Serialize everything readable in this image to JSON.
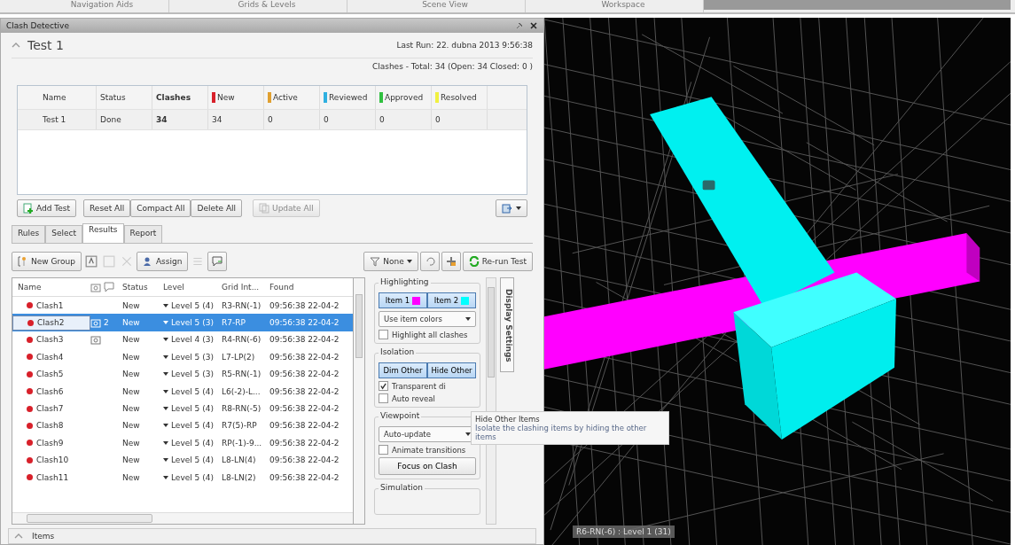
{
  "top_tabs": [
    "Navigation Aids",
    "Grids & Levels",
    "Scene View",
    "Workspace"
  ],
  "panel": {
    "title": "Clash Detective"
  },
  "test": {
    "name": "Test 1",
    "last_run": "Last Run:  22. dubna 2013 9:56:38",
    "summary": "Clashes -  Total:  34  (Open:  34  Closed:  0 )"
  },
  "tests_table": {
    "columns": [
      {
        "label": "Name",
        "kind": "plain"
      },
      {
        "label": "Status",
        "kind": "plain"
      },
      {
        "label": "Clashes",
        "kind": "bold"
      },
      {
        "label": "New",
        "kind": "swatch",
        "color": "#d8202a"
      },
      {
        "label": "Active",
        "kind": "swatch",
        "color": "#e0a030"
      },
      {
        "label": "Reviewed",
        "kind": "swatch",
        "color": "#30b0e0"
      },
      {
        "label": "Approved",
        "kind": "swatch",
        "color": "#30c040"
      },
      {
        "label": "Resolved",
        "kind": "swatch",
        "color": "#f0f040"
      }
    ],
    "rows": [
      [
        "Test 1",
        "Done",
        "34",
        "34",
        "0",
        "0",
        "0",
        "0"
      ]
    ]
  },
  "test_buttons": [
    {
      "label": "Add Test",
      "disabled": false
    },
    {
      "label": "Reset All",
      "disabled": false
    },
    {
      "label": "Compact All",
      "disabled": false
    },
    {
      "label": "Delete All",
      "disabled": false
    },
    {
      "label": "Update All",
      "disabled": true
    }
  ],
  "tabs": [
    {
      "label": "Rules",
      "selected": false
    },
    {
      "label": "Select",
      "selected": false
    },
    {
      "label": "Results",
      "selected": true
    },
    {
      "label": "Report",
      "selected": false
    }
  ],
  "toolbar": {
    "new_group": "New Group",
    "assign": "Assign",
    "filter": "None",
    "rerun": "Re-run Test"
  },
  "results": {
    "columns": [
      "Name",
      "Status",
      "Level",
      "Grid Int...",
      "Found"
    ],
    "rows": [
      {
        "name": "Clash1",
        "viewpoint": false,
        "comments": "",
        "status": "New",
        "level_label": "Level 5 (4)",
        "grid": "R3-RN(-1)",
        "found": "09:56:38 22-04-2",
        "selected": false
      },
      {
        "name": "Clash2",
        "viewpoint": true,
        "comments": "2",
        "status": "New",
        "level_label": "Level 5 (3)",
        "grid": "R7-RP",
        "found": "09:56:38 22-04-2",
        "selected": true
      },
      {
        "name": "Clash3",
        "viewpoint": true,
        "comments": "",
        "status": "New",
        "level_label": "Level 4 (3)",
        "grid": "R4-RN(-6)",
        "found": "09:56:38 22-04-2",
        "selected": false
      },
      {
        "name": "Clash4",
        "viewpoint": false,
        "comments": "",
        "status": "New",
        "level_label": "Level 5 (3)",
        "grid": "L7-LP(2)",
        "found": "09:56:38 22-04-2",
        "selected": false
      },
      {
        "name": "Clash5",
        "viewpoint": false,
        "comments": "",
        "status": "New",
        "level_label": "Level 5 (3)",
        "grid": "R5-RN(-1)",
        "found": "09:56:38 22-04-2",
        "selected": false
      },
      {
        "name": "Clash6",
        "viewpoint": false,
        "comments": "",
        "status": "New",
        "level_label": "Level 5 (4)",
        "grid": "L6(-2)-L...",
        "found": "09:56:38 22-04-2",
        "selected": false
      },
      {
        "name": "Clash7",
        "viewpoint": false,
        "comments": "",
        "status": "New",
        "level_label": "Level 5 (4)",
        "grid": "R8-RN(-5)",
        "found": "09:56:38 22-04-2",
        "selected": false
      },
      {
        "name": "Clash8",
        "viewpoint": false,
        "comments": "",
        "status": "New",
        "level_label": "Level 5 (4)",
        "grid": "R7(5)-RP",
        "found": "09:56:38 22-04-2",
        "selected": false
      },
      {
        "name": "Clash9",
        "viewpoint": false,
        "comments": "",
        "status": "New",
        "level_label": "Level 5 (4)",
        "grid": "RP(-1)-9...",
        "found": "09:56:38 22-04-2",
        "selected": false
      },
      {
        "name": "Clash10",
        "viewpoint": false,
        "comments": "",
        "status": "New",
        "level_label": "Level 5 (4)",
        "grid": "L8-LN(4)",
        "found": "09:56:38 22-04-2",
        "selected": false
      },
      {
        "name": "Clash11",
        "viewpoint": false,
        "comments": "",
        "status": "New",
        "level_label": "Level 5 (4)",
        "grid": "L8-LN(2)",
        "found": "09:56:38 22-04-2",
        "selected": false
      }
    ]
  },
  "display_settings": {
    "tab_label": "Display Settings",
    "highlighting": {
      "title": "Highlighting",
      "items": [
        {
          "label": "Item 1",
          "color": "#ff00ff"
        },
        {
          "label": "Item 2",
          "color": "#00ffff"
        }
      ],
      "mode": "Use item colors",
      "options": [
        {
          "label": "Highlight all clashes",
          "checked": false
        }
      ]
    },
    "isolation": {
      "title": "Isolation",
      "buttons": [
        "Dim Other",
        "Hide Other"
      ],
      "options": [
        {
          "label": "Transparent di",
          "checked": true
        },
        {
          "label": "Auto reveal",
          "checked": false
        }
      ]
    },
    "viewpoint": {
      "title": "Viewpoint",
      "mode": "Auto-update",
      "options": [
        {
          "label": "Animate transitions",
          "checked": false
        }
      ],
      "button": "Focus on Clash"
    },
    "simulation": {
      "title": "Simulation"
    }
  },
  "tooltip": {
    "title": "Hide Other Items",
    "text": "Isolate the clashing items by hiding the other items"
  },
  "viewport": {
    "label": "R6-RN(-6) : Level 1 (31)"
  },
  "items_bar": {
    "label": "Items"
  }
}
